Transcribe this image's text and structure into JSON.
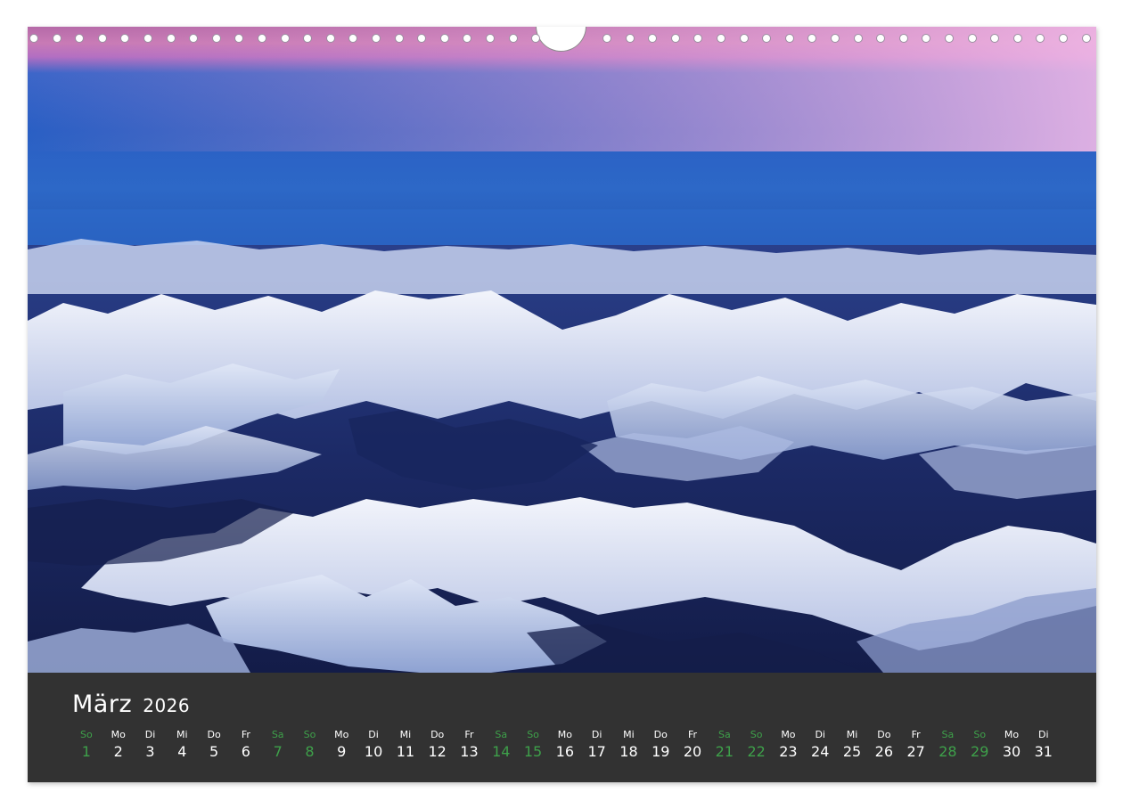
{
  "calendar": {
    "month": "März",
    "year": "2026"
  },
  "days": [
    {
      "name": "So",
      "num": "1",
      "weekend": true
    },
    {
      "name": "Mo",
      "num": "2",
      "weekend": false
    },
    {
      "name": "Di",
      "num": "3",
      "weekend": false
    },
    {
      "name": "Mi",
      "num": "4",
      "weekend": false
    },
    {
      "name": "Do",
      "num": "5",
      "weekend": false
    },
    {
      "name": "Fr",
      "num": "6",
      "weekend": false
    },
    {
      "name": "Sa",
      "num": "7",
      "weekend": true
    },
    {
      "name": "So",
      "num": "8",
      "weekend": true
    },
    {
      "name": "Mo",
      "num": "9",
      "weekend": false
    },
    {
      "name": "Di",
      "num": "10",
      "weekend": false
    },
    {
      "name": "Mi",
      "num": "11",
      "weekend": false
    },
    {
      "name": "Do",
      "num": "12",
      "weekend": false
    },
    {
      "name": "Fr",
      "num": "13",
      "weekend": false
    },
    {
      "name": "Sa",
      "num": "14",
      "weekend": true
    },
    {
      "name": "So",
      "num": "15",
      "weekend": true
    },
    {
      "name": "Mo",
      "num": "16",
      "weekend": false
    },
    {
      "name": "Di",
      "num": "17",
      "weekend": false
    },
    {
      "name": "Mi",
      "num": "18",
      "weekend": false
    },
    {
      "name": "Do",
      "num": "19",
      "weekend": false
    },
    {
      "name": "Fr",
      "num": "20",
      "weekend": false
    },
    {
      "name": "Sa",
      "num": "21",
      "weekend": true
    },
    {
      "name": "So",
      "num": "22",
      "weekend": true
    },
    {
      "name": "Mo",
      "num": "23",
      "weekend": false
    },
    {
      "name": "Di",
      "num": "24",
      "weekend": false
    },
    {
      "name": "Mi",
      "num": "25",
      "weekend": false
    },
    {
      "name": "Do",
      "num": "26",
      "weekend": false
    },
    {
      "name": "Fr",
      "num": "27",
      "weekend": false
    },
    {
      "name": "Sa",
      "num": "28",
      "weekend": true
    },
    {
      "name": "So",
      "num": "29",
      "weekend": true
    },
    {
      "name": "Mo",
      "num": "30",
      "weekend": false
    },
    {
      "name": "Di",
      "num": "31",
      "weekend": false
    }
  ],
  "colors": {
    "weekend": "#3ea04a",
    "weekday": "#ffffff",
    "band": "#323232"
  },
  "photo": {
    "subject": "mountain-range-aerial-image"
  }
}
